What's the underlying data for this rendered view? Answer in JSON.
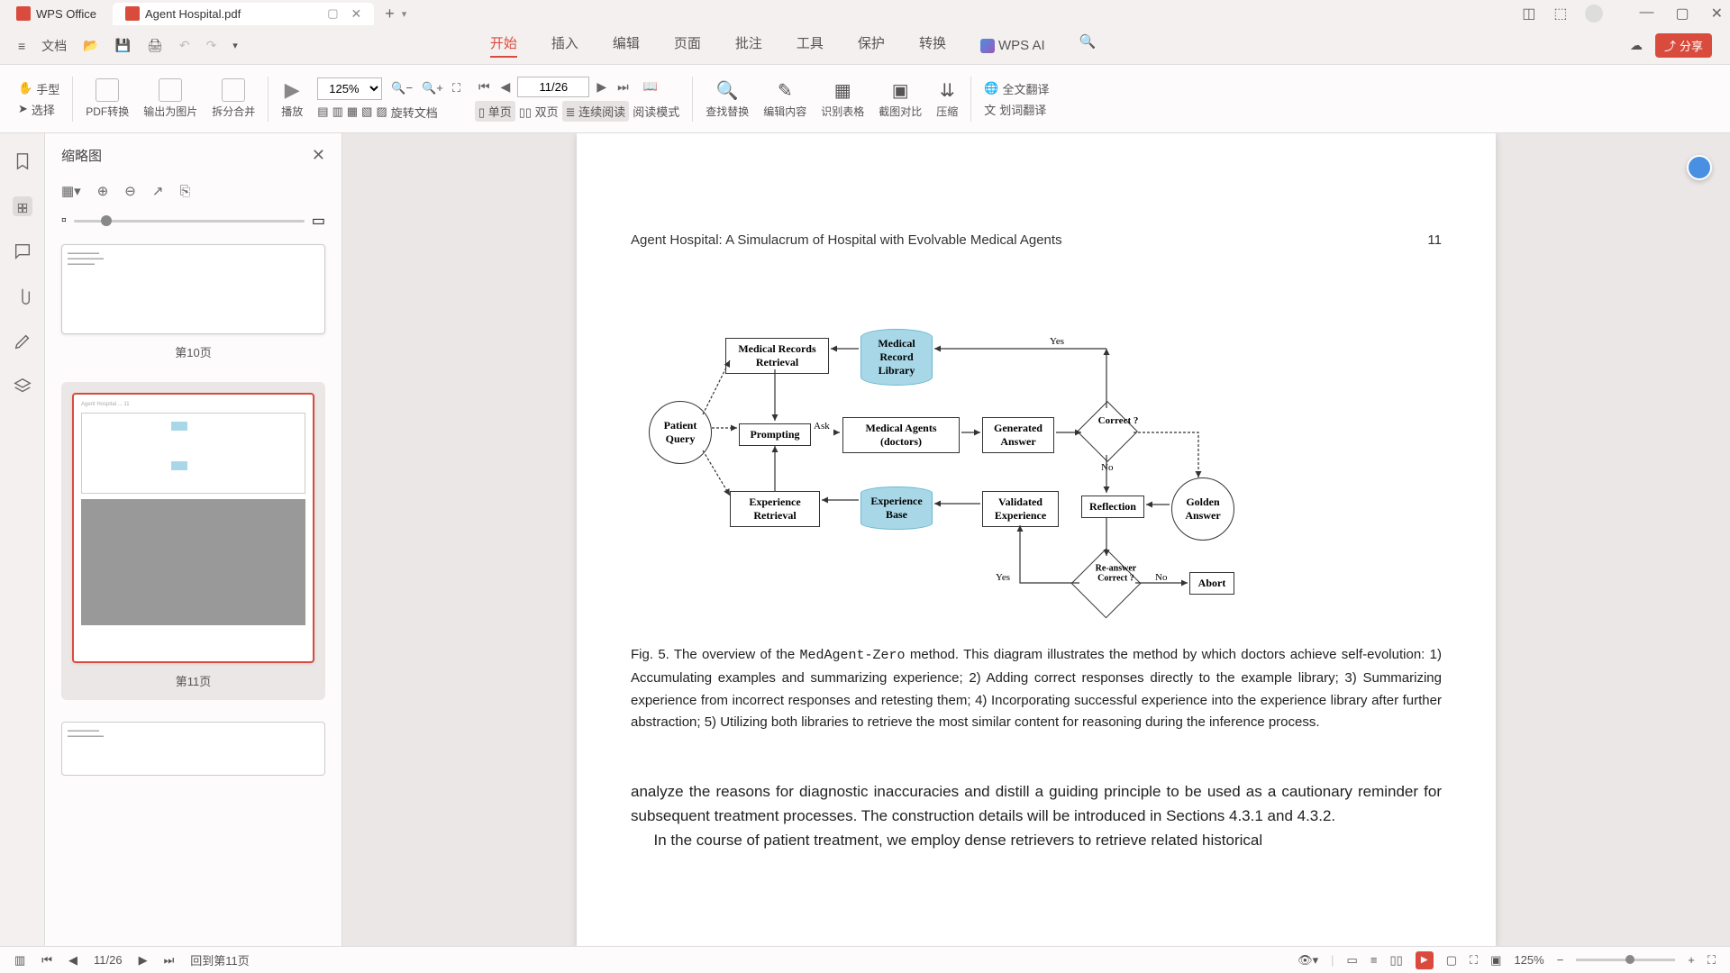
{
  "titlebar": {
    "app_name": "WPS Office",
    "doc_name": "Agent Hospital.pdf",
    "add_tab": "+"
  },
  "menubar": {
    "file": "文档",
    "tabs": [
      "开始",
      "插入",
      "编辑",
      "页面",
      "批注",
      "工具",
      "保护",
      "转换"
    ],
    "active_tab": "开始",
    "wps_ai": "WPS AI",
    "share": "分享"
  },
  "toolbar": {
    "hand": "手型",
    "select": "选择",
    "pdf_convert": "PDF转换",
    "export_img": "输出为图片",
    "split_merge": "拆分合并",
    "play": "播放",
    "zoom": "125%",
    "page": "11/26",
    "rotate": "旋转文档",
    "single": "单页",
    "double": "双页",
    "continuous": "连续阅读",
    "read_mode": "阅读模式",
    "find_replace": "查找替换",
    "edit_content": "编辑内容",
    "recognize_table": "识别表格",
    "screenshot_compare": "截图对比",
    "compress": "压缩",
    "full_translate": "全文翻译",
    "word_translate": "划词翻译"
  },
  "thumb_panel": {
    "title": "缩略图",
    "pages": [
      {
        "label": "第10页"
      },
      {
        "label": "第11页"
      }
    ]
  },
  "document": {
    "header_title": "Agent Hospital: A Simulacrum of Hospital with Evolvable Medical Agents",
    "page_num": "11",
    "diagram": {
      "patient_query": "Patient Query",
      "medical_records_retrieval": "Medical Records Retrieval",
      "prompting": "Prompting",
      "experience_retrieval": "Experience Retrieval",
      "medical_record_library": "Medical Record Library",
      "medical_agents": "Medical Agents (doctors)",
      "experience_base": "Experience Base",
      "generated_answer": "Generated Answer",
      "validated_experience": "Validated Experience",
      "correct": "Correct ?",
      "reflection": "Reflection",
      "reanswer_correct": "Re-answer Correct ?",
      "golden_answer": "Golden Answer",
      "abort": "Abort",
      "yes": "Yes",
      "no": "No",
      "ask": "Ask"
    },
    "fig_label": "Fig. 5.  The overview of the ",
    "fig_mono": "MedAgent-Zero",
    "caption": " method. This diagram illustrates the method by which doctors achieve self-evolution: 1) Accumulating examples and summarizing experience; 2) Adding correct responses directly to the example library; 3) Summarizing experience from incorrect responses and retesting them; 4) Incorporating successful experience into the experience library after further abstraction; 5) Utilizing both libraries to retrieve the most similar content for reasoning during the inference process.",
    "para1": "analyze the reasons for diagnostic inaccuracies and distill a guiding principle to be used as a cautionary reminder for subsequent treatment processes. The construction details will be introduced in Sections 4.3.1 and 4.3.2.",
    "para2": "In the course of patient treatment, we employ dense retrievers to retrieve related historical"
  },
  "statusbar": {
    "page": "11/26",
    "back_to": "回到第11页",
    "zoom": "125%"
  }
}
